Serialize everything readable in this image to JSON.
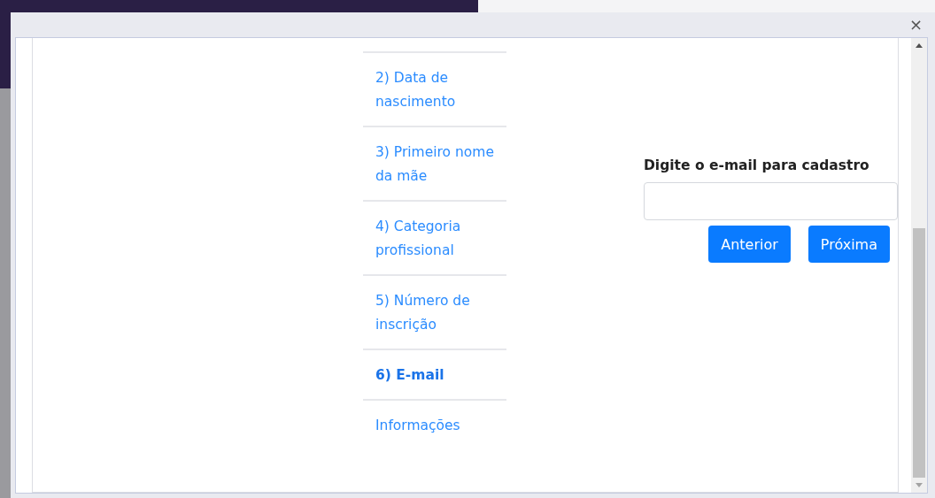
{
  "dialog": {
    "close": "×"
  },
  "steps": [
    {
      "label": "2) Data de nascimento",
      "selected": false
    },
    {
      "label": "3) Primeiro nome da mãe",
      "selected": false
    },
    {
      "label": "4) Categoria profissional",
      "selected": false
    },
    {
      "label": "5) Número de inscrição",
      "selected": false
    },
    {
      "label": "6) E-mail",
      "selected": true
    },
    {
      "label": "Informações",
      "selected": false
    }
  ],
  "form": {
    "label": "Digite o e-mail para cadastro",
    "buttons": [
      "Anterior",
      "Próxima"
    ]
  }
}
